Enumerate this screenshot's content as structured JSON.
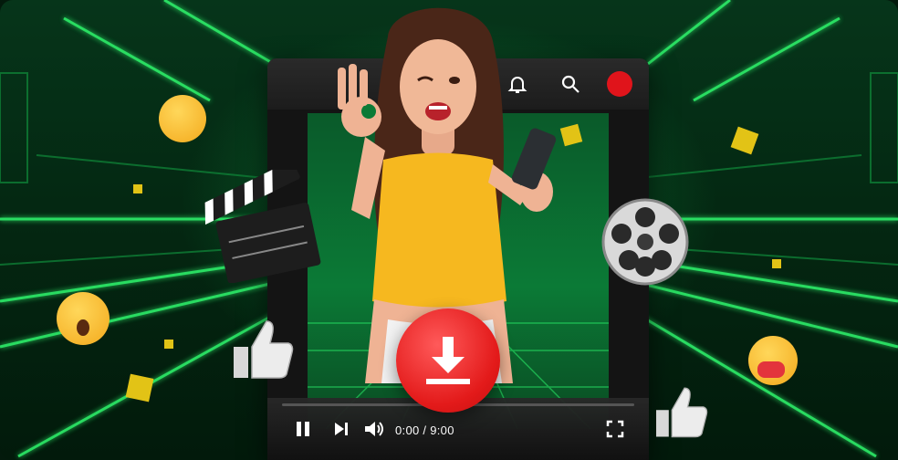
{
  "player": {
    "time": "0:00 / 9:00",
    "progress": 0
  },
  "icons": {
    "top_bar": [
      "bell-icon",
      "search-icon",
      "record-icon"
    ],
    "controls": [
      "pause-icon",
      "next-icon",
      "volume-icon",
      "fullscreen-icon"
    ],
    "center": "download-icon"
  },
  "colors": {
    "accent_green": "#1fe05a",
    "record_red": "#e0141b",
    "download_red": "#e31a1a",
    "top_color": "#f6b81f"
  }
}
